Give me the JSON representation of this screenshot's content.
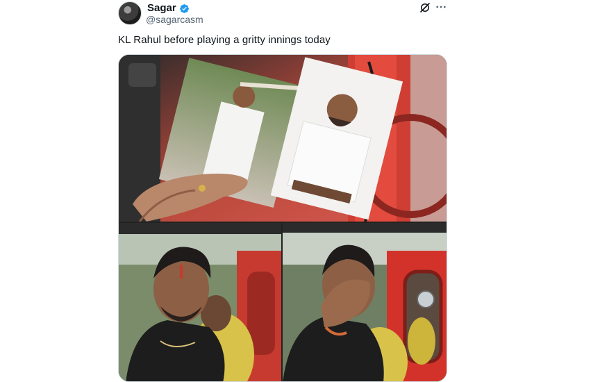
{
  "tweet": {
    "author_name": "Sagar",
    "author_handle": "@sagarcasm",
    "verified": true,
    "text": "KL Rahul before playing a gritty innings today"
  },
  "media": {
    "type": "meme-image",
    "panels": [
      "top-photos-hand",
      "bottom-left-man-in-jeep",
      "bottom-right-man-covering-face"
    ]
  },
  "icons": {
    "verified": "verified-badge-icon",
    "grok": "grok-icon",
    "more": "more-options-icon"
  },
  "colors": {
    "verified_blue": "#1d9bf0",
    "text_primary": "#0f1419",
    "text_secondary": "#536471",
    "border": "#cfd9de",
    "jeep_red": "#d3322a"
  }
}
